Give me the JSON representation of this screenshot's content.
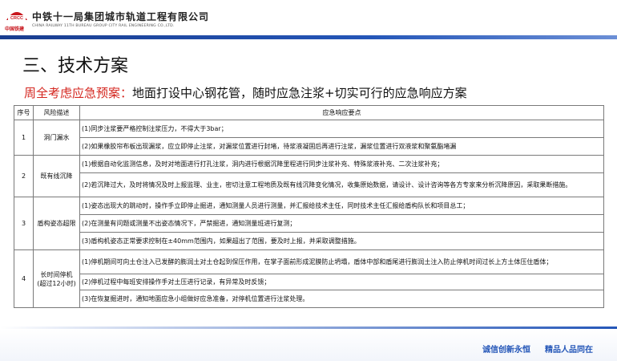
{
  "header": {
    "logo_text": "CRCC",
    "logo_sub": "中国铁建",
    "company_cn": "中铁十一局集团城市轨道工程有限公司",
    "company_en": "CHINA RAILWAY 11TH BUREAU GROUP CITY RAIL ENGINEERING CO.,LTD.",
    "brand_color": "#c8161d",
    "bar_color": "#2456b8"
  },
  "title": "三、技术方案",
  "subtitle": {
    "highlight": "周全考虑应急预案：",
    "rest": "地面打设中心钢花管，随时应急注浆+切实可行的应急响应方案",
    "highlight_color": "#d4261f"
  },
  "table": {
    "headers": [
      "序号",
      "风险描述",
      "应急响应要点"
    ],
    "rows": [
      {
        "no": "1",
        "risk": "洞门漏水",
        "points": [
          "(1)同步注浆要严格控制注浆压力，不得大于3bar；",
          "(2)如果橡胶帘布板出现漏浆，应立即停止注浆，对漏浆位置进行封堵，待浆液凝固后再进行注浆，漏浆位置进行双液浆和聚氨酯堵漏"
        ]
      },
      {
        "no": "2",
        "risk": "既有线沉降",
        "points": [
          "(1)根据自动化监测信息，及时对地面进行打孔注浆，洞内进行根据沉降里程进行同步注浆补充、特殊浆液补充、二次注浆补充；",
          "(2)若沉降过大，及时将情况及时上报监理、业主，密切注意工程地质及既有线沉降变化情况，收集原始数据，请设计、设计咨询等各方专家来分析沉降原因，采取果断措施。"
        ]
      },
      {
        "no": "3",
        "risk": "盾构姿态超限",
        "points": [
          "(1)姿态出现大的跳动时，操作手立即停止掘进，通知测量人员进行测量，并汇报给技术主任，同时技术主任汇报给盾构队长和项目总工；",
          "(2)在测量有问题或测量不出姿态情况下，严禁掘进，通知测量班进行复测；",
          "(3)盾构机姿态正常要求控制在±40mm范围内，如果超出了范围，要及时上报，并采取调整措施。"
        ]
      },
      {
        "no": "4",
        "risk": "长时间停机(超过12小时)",
        "risk_line1": "长时间停机",
        "risk_line2": "(超过12小时)",
        "points": [
          "(1)停机期间可向土仓注入已发酵的膨润土对土仓起到保压作用，在掌子面前形成泥膜防止坍塌，盾体中部和盾尾进行膨润土注入防止停机时间过长上方土体压住盾体；",
          "(2)停机过程中每班安排操作手对土压进行记录，有异常及时反馈；",
          "(3)在恢复掘进时，通知地面应急小组做好应急准备，对停机位置进行注浆处理。"
        ]
      }
    ]
  },
  "footer": {
    "slogan1": "诚信创新永恒",
    "slogan2": "精品人品同在",
    "color": "#2456b8"
  }
}
